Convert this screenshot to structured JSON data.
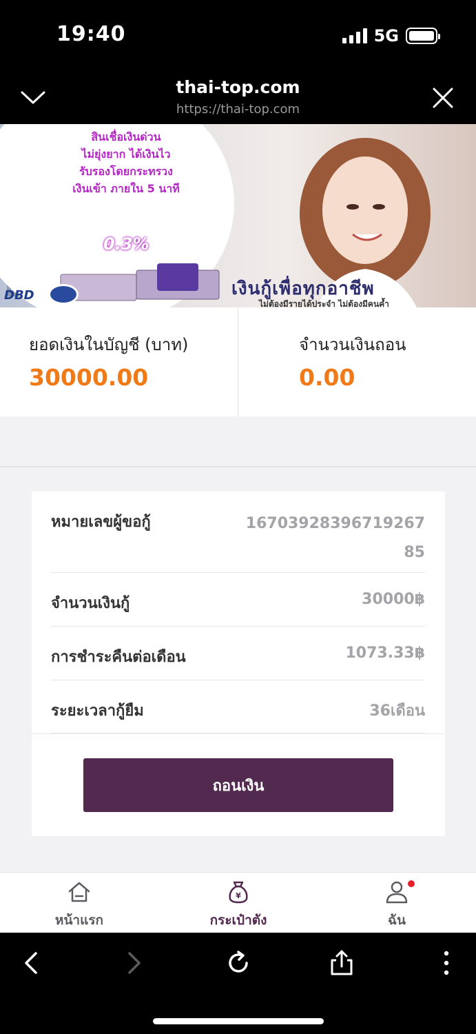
{
  "status_bar": {
    "time": "19:40",
    "network": "5G"
  },
  "browser": {
    "title": "thai-top.com",
    "url": "https://thai-top.com"
  },
  "banner": {
    "headline_lines": [
      "สินเชื่อเงินด่วน",
      "ไม่ยุ่งยาก ได้เงินไว",
      "รับรองโดยกระทรวง",
      "เงินเข้า ภายใน 5 นาที"
    ],
    "rate": "0.3%",
    "slogan": "เงินกู้เพื่อทุกอาชีพ",
    "subline": "ไม่ต้องมีรายได้ประจำ ไม่ต้องมีคนค้ำ",
    "logo_text": "DBD"
  },
  "balances": {
    "account_label": "ยอดเงินในบัญชี (บาท)",
    "account_value": "30000.00",
    "withdraw_label": "จำนวนเงินถอน",
    "withdraw_value": "0.00"
  },
  "details": {
    "rows": [
      {
        "label": "หมายเลขผู้ขอกู้",
        "value": "1670392839671926785"
      },
      {
        "label": "จำนวนเงินกู้",
        "value": "30000฿"
      },
      {
        "label": "การชำระคืนต่อเดือน",
        "value": "1073.33฿"
      },
      {
        "label": "ระยะเวลากู้ยืม",
        "value": "36เดือน"
      }
    ],
    "withdraw_button": "ถอนเงิน"
  },
  "tabbar": {
    "items": [
      {
        "label": "หน้าแรก",
        "icon": "home-icon"
      },
      {
        "label": "กระเป๋าตัง",
        "icon": "wallet-icon",
        "active": true
      },
      {
        "label": "ฉัน",
        "icon": "user-icon"
      }
    ]
  },
  "colors": {
    "accent": "#52294f",
    "value_orange": "#f07a18",
    "notification_dot": "#e5202a"
  }
}
